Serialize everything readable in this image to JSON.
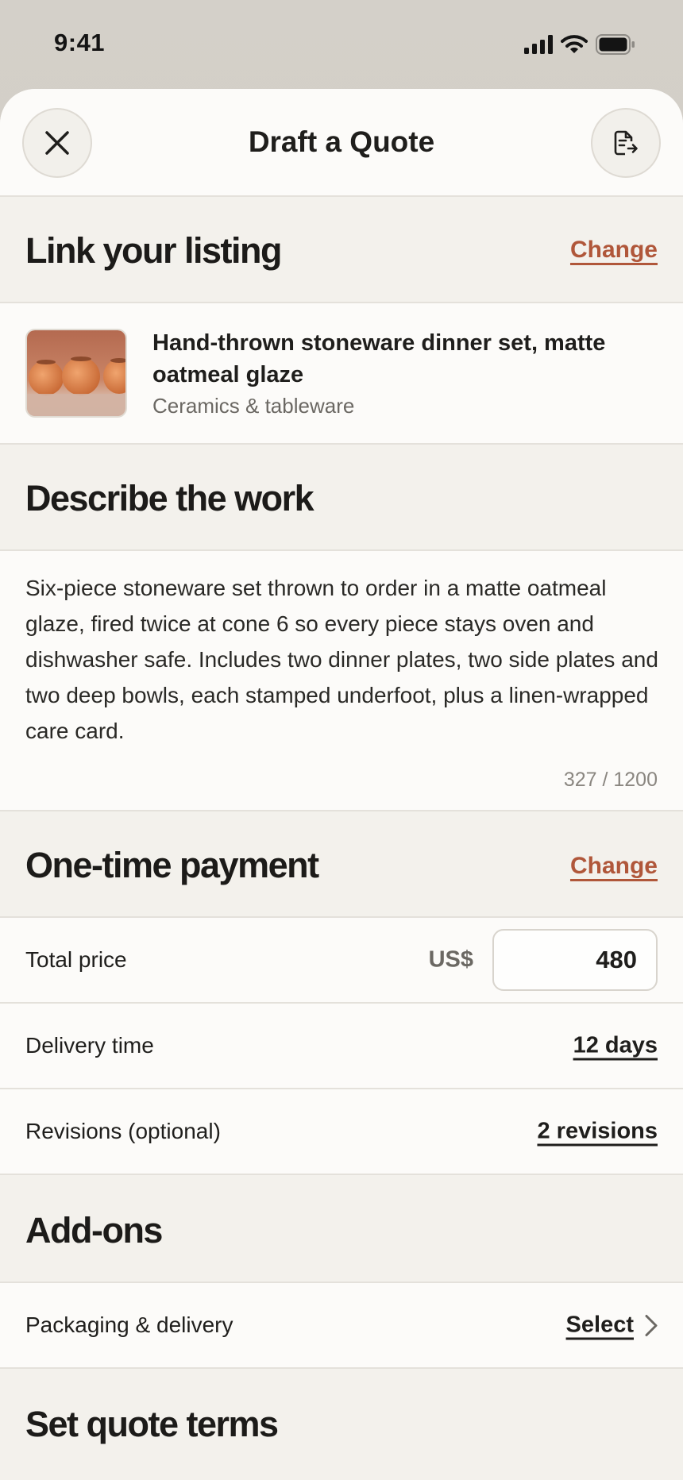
{
  "status_bar": {
    "time": "9:41"
  },
  "header": {
    "title": "Draft a Quote",
    "close_icon": "close-icon",
    "export_icon": "document-export-icon"
  },
  "listing_section": {
    "title": "Link your listing",
    "change_label": "Change",
    "item": {
      "title": "Hand-thrown stoneware dinner set, matte oatmeal glaze",
      "category": "Ceramics & tableware"
    }
  },
  "describe_section": {
    "title": "Describe the work",
    "text": "Six-piece stoneware set thrown to order in a matte oatmeal glaze, fired twice at cone 6 so every piece stays oven and dishwasher safe. Includes two dinner plates, two side plates and two deep bowls, each stamped underfoot, plus a linen-wrapped care card.",
    "char_count": "327 / 1200"
  },
  "payment_section": {
    "title": "One-time payment",
    "change_label": "Change",
    "total_price": {
      "label": "Total price",
      "currency": "US$",
      "value": "480"
    },
    "delivery_time": {
      "label": "Delivery time",
      "value": "12 days"
    },
    "revisions": {
      "label": "Revisions (optional)",
      "value": "2 revisions"
    }
  },
  "addons_section": {
    "title": "Add-ons",
    "packaging": {
      "label": "Packaging & delivery",
      "action": "Select",
      "icon": "chevron-right-icon"
    }
  },
  "terms_section": {
    "title": "Set quote terms"
  },
  "colors": {
    "accent": "#b0573a",
    "sheet_bg": "#f3f1ec",
    "row_bg": "#fcfbf9",
    "divider": "#e4e1db"
  }
}
